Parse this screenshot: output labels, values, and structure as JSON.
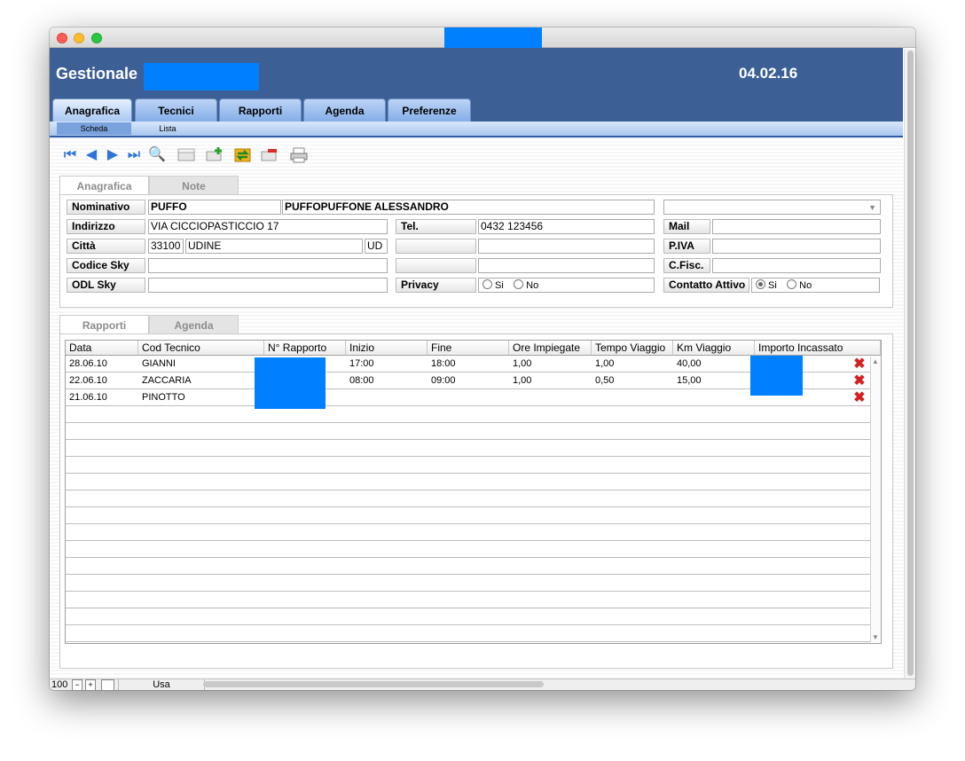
{
  "app": {
    "title": "Gestionale",
    "date": "04.02.16"
  },
  "main_tabs": [
    "Anagrafica",
    "Tecnici",
    "Rapporti",
    "Agenda",
    "Preferenze"
  ],
  "sub_tabs": [
    "Scheda",
    "Lista"
  ],
  "toolbar": {
    "icons": [
      "first-record-icon",
      "prev-record-icon",
      "next-record-icon",
      "last-record-icon",
      "search-icon",
      "empty-record-icon",
      "add-record-icon",
      "sync-icon",
      "delete-record-icon",
      "print-icon"
    ]
  },
  "record_tabs": [
    "Anagrafica",
    "Note"
  ],
  "record": {
    "nominativo_label": "Nominativo",
    "nominativo_short": "PUFFO",
    "nominativo_full": "PUFFOPUFFONE ALESSANDRO",
    "indirizzo_label": "Indirizzo",
    "indirizzo": "VIA CICCIOPASTICCIO 17",
    "citta_label": "Città",
    "cap": "33100",
    "citta": "UDINE",
    "prov": "UD",
    "codice_sky_label": "Codice Sky",
    "codice_sky": "",
    "odl_sky_label": "ODL Sky",
    "odl_sky": "",
    "tel_label": "Tel.",
    "tel": "0432 123456",
    "privacy_label": "Privacy",
    "privacy_options": [
      "Si",
      "No"
    ],
    "mail_label": "Mail",
    "mail": "",
    "piva_label": "P.IVA",
    "piva": "",
    "cfisc_label": "C.Fisc.",
    "cfisc": "",
    "contatto_label": "Contatto Attivo",
    "contatto_options": [
      "Si",
      "No"
    ],
    "contatto_selected": "Si"
  },
  "bottom_tabs": [
    "Rapporti",
    "Agenda"
  ],
  "table": {
    "columns": [
      "Data",
      "Cod Tecnico",
      "N° Rapporto",
      "Inizio",
      "Fine",
      "Ore Impiegate",
      "Tempo Viaggio",
      "Km Viaggio",
      "Importo Incassato"
    ],
    "rows": [
      [
        "28.06.10",
        "GIANNI",
        "",
        "17:00",
        "18:00",
        "1,00",
        "1,00",
        "40,00",
        ""
      ],
      [
        "22.06.10",
        "ZACCARIA",
        "",
        "08:00",
        "09:00",
        "1,00",
        "0,50",
        "15,00",
        ""
      ],
      [
        "21.06.10",
        "PINOTTO",
        "",
        "",
        "",
        "",
        "",
        "",
        ""
      ]
    ]
  },
  "status": {
    "zoom": "100",
    "mode": "Usa"
  },
  "colors": {
    "header_bg": "#3c5f95",
    "redaction": "#0080ff",
    "delete_icon": "#d42020"
  }
}
